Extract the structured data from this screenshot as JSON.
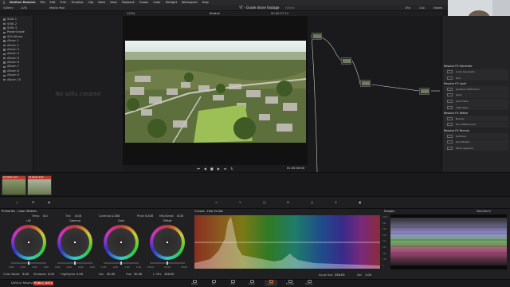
{
  "menubar": {
    "apple": "",
    "app_name": "DaVinci Resolve",
    "items": [
      "File",
      "Edit",
      "Trim",
      "Timeline",
      "Clip",
      "Mark",
      "View",
      "Playback",
      "Fusion",
      "Color",
      "Fairlight",
      "Workspace",
      "Help"
    ]
  },
  "toolbar": {
    "gallery_label": "Gallery",
    "lut_label": "LUTs",
    "media_pool_label": "Media Pool",
    "project_title": "YT - Grade drone footage",
    "project_status": "Edited",
    "zoom": "29p",
    "clip_label": "Clip",
    "nodes_label": "Nodes"
  },
  "viewer": {
    "zoom": "119%",
    "clip_name": "Stretch",
    "timecode_top": "00:00:27:12",
    "timecode_bottom": "01:00:00:00"
  },
  "gallery": {
    "albums": [
      "Stills 1",
      "Stills 2",
      "Stills 3",
      "PowerGrade",
      "Still Album",
      "Album 1",
      "Album 2",
      "Album 3",
      "Album 4",
      "Album 5",
      "Album 6",
      "Album 7",
      "Album 8",
      "Album 9",
      "Album 10"
    ],
    "empty_text": "No stills created"
  },
  "fx_library": {
    "sections": [
      {
        "title": "Resolve FX Generate",
        "items": [
          "Color Generator",
          "Grid"
        ]
      },
      {
        "title": "Resolve FX Light",
        "items": [
          "Aperture Diffraction",
          "Glow",
          "Lens Flare",
          "Light Rays"
        ]
      },
      {
        "title": "Resolve FX Refine",
        "items": [
          "Beauty",
          "Face Refinement"
        ]
      },
      {
        "title": "Resolve FX Revival",
        "items": [
          "Deflicker",
          "Dust Buster",
          "Patch Replacer"
        ]
      }
    ]
  },
  "clips": [
    {
      "label": "01  00:01:14:5",
      "color": "#c23b2e"
    },
    {
      "label": "02  00:01:22:9",
      "color": "#c23b2e"
    }
  ],
  "wheels_panel": {
    "title": "Primaries - Color Wheels",
    "temp_label": "Temp",
    "temp_value": "0.0",
    "tint_label": "Tint",
    "tint_value": "0.00",
    "contrast_label": "Contrast",
    "contrast_value": "1.000",
    "pivot_label": "Pivot",
    "pivot_value": "0.435",
    "md_label": "Mid/Detail",
    "md_value": "0.00",
    "wheels": [
      {
        "name": "Lift",
        "values": [
          "0.00",
          "0.00",
          "0.00",
          "0.00"
        ]
      },
      {
        "name": "Gamma",
        "values": [
          "0.00",
          "0.00",
          "0.00",
          "0.00"
        ]
      },
      {
        "name": "Gain",
        "values": [
          "1.00",
          "1.00",
          "1.00",
          "1.00"
        ]
      },
      {
        "name": "Offset",
        "values": [
          "25.00",
          "25.00",
          "25.00"
        ]
      }
    ],
    "boost_label": "Color Boost",
    "boost_value": "0.00",
    "shadows_label": "Shadows",
    "shadows_value": "0.00",
    "hl_label": "Highlights",
    "hl_value": "0.00",
    "sat_label": "Sat",
    "sat_value": "50.00",
    "hue_label": "Hue",
    "hue_value": "50.00",
    "lmix_label": "L. Mix",
    "lmix_value": "100.00"
  },
  "curves_panel": {
    "title": "Curves - Hue Vs Sat",
    "input_hue_label": "Input Hue",
    "input_hue_value": "256.00",
    "sat_label": "Sat",
    "sat_value": "1.00"
  },
  "scopes_panel": {
    "title": "Scopes",
    "mode": "Waveform",
    "scale": [
      "1023",
      "896",
      "768",
      "640",
      "512",
      "384",
      "256",
      "128",
      "0"
    ]
  },
  "pages": [
    "Media",
    "Cut",
    "Edit",
    "Fusion",
    "Color",
    "Fairlight",
    "Deliver"
  ],
  "active_page": "Color",
  "app_footer": "DaVinci Resolve 18",
  "footer_badge": "PUBLIC BETA",
  "colors": {
    "accent": "#e06a45",
    "panel_bg": "#202022",
    "clip_flag": "#c23b2e"
  }
}
